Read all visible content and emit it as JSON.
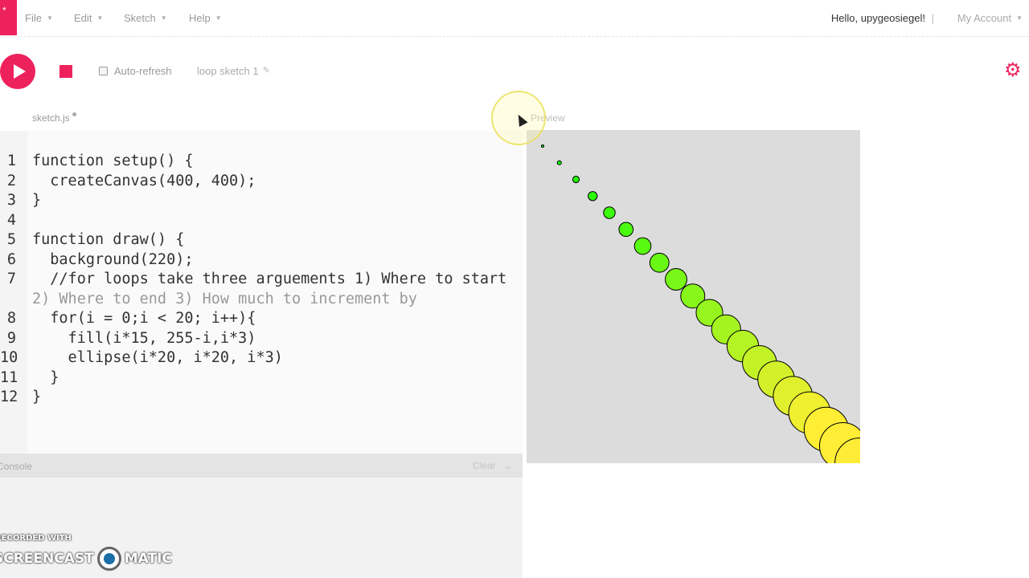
{
  "nav": {
    "logo": "*",
    "menus": [
      {
        "label": "File"
      },
      {
        "label": "Edit"
      },
      {
        "label": "Sketch"
      },
      {
        "label": "Help"
      }
    ],
    "greeting": "Hello, upygeosiegel!",
    "separator": "|",
    "account_label": "My Account"
  },
  "toolbar": {
    "auto_refresh_label": "Auto-refresh",
    "auto_refresh_checked": false,
    "sketch_name": "loop sketch 1"
  },
  "editor": {
    "file_name": "sketch.js",
    "unsaved": true,
    "lines": [
      {
        "n": "1",
        "code": "function setup() {"
      },
      {
        "n": "2",
        "code": "  createCanvas(400, 400);"
      },
      {
        "n": "3",
        "code": "}"
      },
      {
        "n": "4",
        "code": ""
      },
      {
        "n": "5",
        "code": "function draw() {"
      },
      {
        "n": "6",
        "code": "  background(220);"
      },
      {
        "n": "7",
        "code": "  //for loops take three arguements 1) Where to start"
      },
      {
        "n": "",
        "code": "2) Where to end 3) How much to increment by"
      },
      {
        "n": "8",
        "code": "  for(i = 0;i < 20; i++){"
      },
      {
        "n": "9",
        "code": "    fill(i*15, 255-i,i*3)"
      },
      {
        "n": "10",
        "code": "    ellipse(i*20, i*20, i*3)"
      },
      {
        "n": "11",
        "code": "  }"
      },
      {
        "n": "12",
        "code": "}"
      }
    ],
    "active_line": "9"
  },
  "console": {
    "title": "Console",
    "clear_label": "Clear"
  },
  "preview": {
    "label": "Preview",
    "background": "#dcdcdc",
    "circle_count": 20
  },
  "watermark": {
    "top": "RECORDED WITH",
    "main_left": "SCREENCAST",
    "main_right": "MATIC"
  },
  "colors": {
    "accent": "#ed225d"
  }
}
